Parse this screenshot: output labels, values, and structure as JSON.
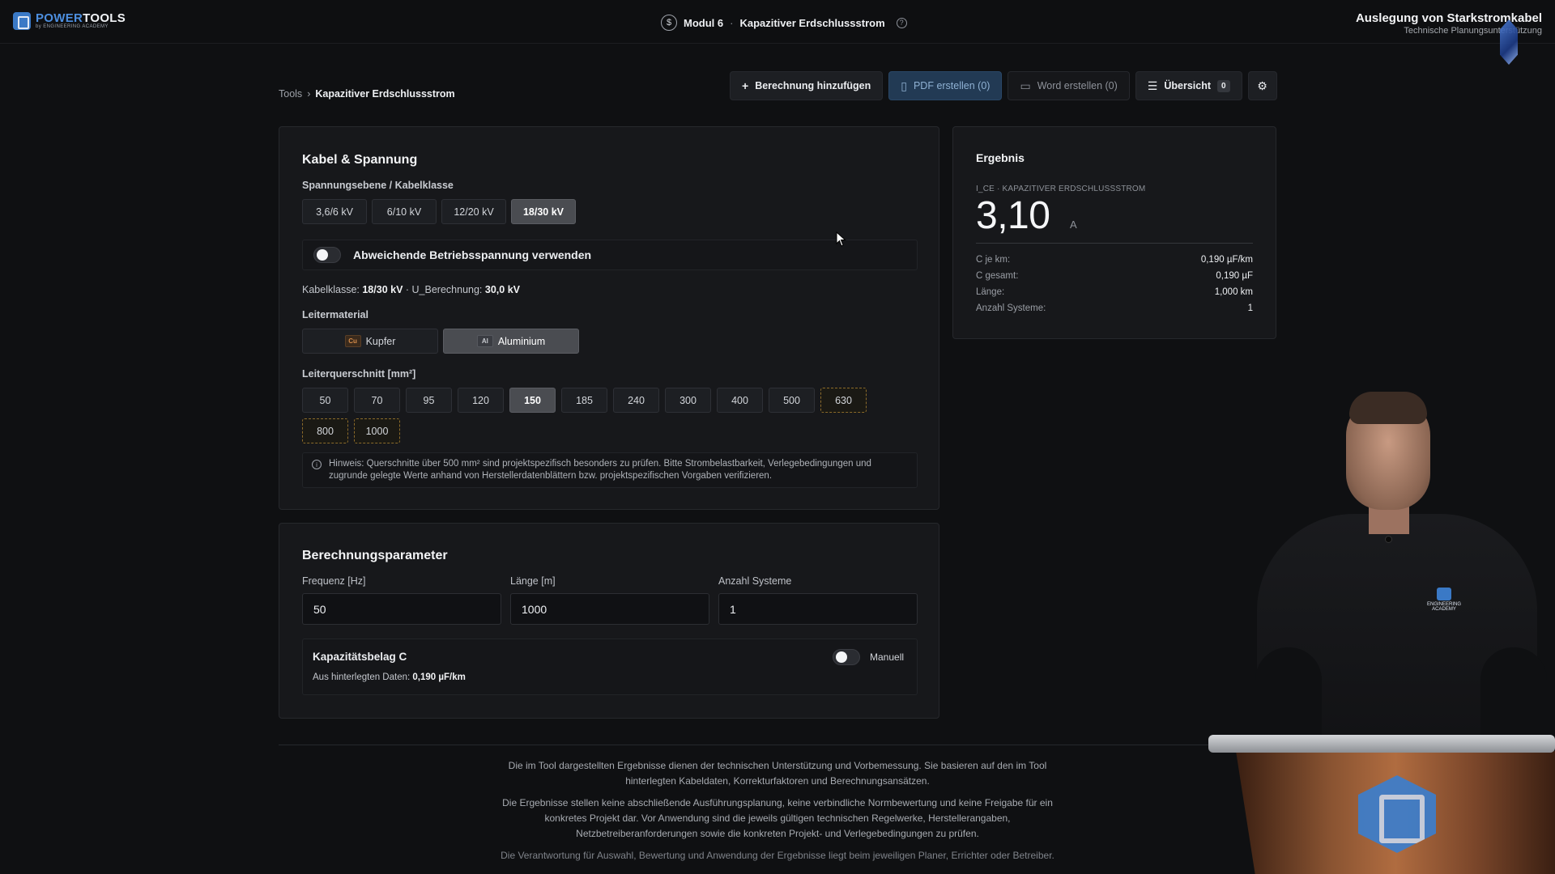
{
  "header": {
    "logo_power": "POWER",
    "logo_tools": "TOOLS",
    "logo_sub": "by ENGINEERING ACADEMY",
    "module_label": "Modul 6",
    "module_sep": "·",
    "module_title": "Kapazitiver Erdschlussstrom",
    "course_title": "Auslegung von Starkstromkabel",
    "course_sub": "Technische Planungsunterstützung"
  },
  "breadcrumb": {
    "root": "Tools",
    "sep": "›",
    "current": "Kapazitiver Erdschlussstrom"
  },
  "toolbar": {
    "add": "Berechnung hinzufügen",
    "pdf": "PDF erstellen (0)",
    "word": "Word erstellen (0)",
    "overview": "Übersicht",
    "overview_count": "0"
  },
  "cable": {
    "title": "Kabel & Spannung",
    "voltage_label": "Spannungsebene / Kabelklasse",
    "voltages": [
      "3,6/6 kV",
      "6/10 kV",
      "12/20 kV",
      "18/30 kV"
    ],
    "voltage_selected": "18/30 kV",
    "toggle_label": "Abweichende Betriebsspannung verwenden",
    "class_prefix": "Kabelklasse:",
    "class_value": "18/30 kV",
    "calc_prefix": "· U_Berechnung:",
    "calc_value": "30,0 kV",
    "material_label": "Leitermaterial",
    "material_cu_chip": "Cu",
    "material_cu": "Kupfer",
    "material_al_chip": "Al",
    "material_al": "Aluminium",
    "material_selected": "Aluminium",
    "cross_label": "Leiterquerschnitt [mm²]",
    "cross_sections": [
      "50",
      "70",
      "95",
      "120",
      "150",
      "185",
      "240",
      "300",
      "400",
      "500",
      "630",
      "800",
      "1000"
    ],
    "cross_selected": "150",
    "note_line1": "Hinweis: Querschnitte über 500 mm² sind projektspezifisch besonders zu prüfen. Bitte Strombelastbarkeit, Verlegebedingungen und",
    "note_line2": "zugrunde gelegte Werte anhand von Herstellerdatenblättern bzw. projektspezifischen Vorgaben verifizieren."
  },
  "params": {
    "title": "Berechnungsparameter",
    "freq_label": "Frequenz [Hz]",
    "freq_value": "50",
    "length_label": "Länge [m]",
    "length_value": "1000",
    "systems_label": "Anzahl Systeme",
    "systems_value": "1",
    "cap_title": "Kapazitätsbelag C",
    "cap_mode": "Manuell",
    "cap_source_prefix": "Aus hinterlegten Daten:",
    "cap_source_value": "0,190 µF/km"
  },
  "result": {
    "title": "Ergebnis",
    "label": "I_CE · KAPAZITIVER ERDSCHLUSSSTROM",
    "value": "3,10",
    "unit": "A",
    "rows": [
      {
        "k": "C je km:",
        "v": "0,190 µF/km"
      },
      {
        "k": "C gesamt:",
        "v": "0,190 µF"
      },
      {
        "k": "Länge:",
        "v": "1,000 km"
      },
      {
        "k": "Anzahl Systeme:",
        "v": "1"
      }
    ]
  },
  "footer": {
    "p1a": "Die im Tool dargestellten Ergebnisse dienen der technischen Unterstützung und Vorbemessung. Sie basieren auf den im Tool",
    "p1b": "hinterlegten Kabeldaten, Korrekturfaktoren und Berechnungsansätzen.",
    "p2a": "Die Ergebnisse stellen keine abschließende Ausführungsplanung, keine verbindliche Normbewertung und keine Freigabe für ein",
    "p2b": "konkretes Projekt dar. Vor Anwendung sind die jeweils gültigen technischen Regelwerke, Herstellerangaben,",
    "p2c": "Netzbetreiberanforderungen sowie die konkreten Projekt- und Verlegebedingungen zu prüfen.",
    "p3": "Die Verantwortung für Auswahl, Bewertung und Anwendung der Ergebnisse liegt beim jeweiligen Planer, Errichter oder Betreiber."
  },
  "presenter_shirt_logo": "ENGINEERING ACADEMY",
  "colors": {
    "background": "#0f1012",
    "card": "#17181b",
    "selected": "#4a4c51",
    "primary": "#223a54",
    "warn_border": "#8c6b2a"
  }
}
